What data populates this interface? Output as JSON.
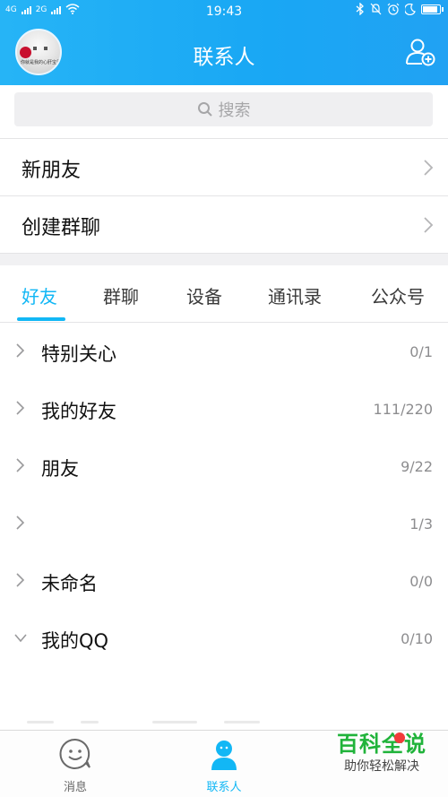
{
  "status_bar": {
    "network_1": "4G",
    "network_2": "2G",
    "time": "19:43"
  },
  "header": {
    "title": "联系人",
    "avatar_caption": "你就是我的心肝宝贝"
  },
  "search": {
    "placeholder": "搜索"
  },
  "menu": [
    {
      "label": "新朋友"
    },
    {
      "label": "创建群聊"
    }
  ],
  "tabs": [
    {
      "label": "好友",
      "active": true
    },
    {
      "label": "群聊",
      "active": false
    },
    {
      "label": "设备",
      "active": false
    },
    {
      "label": "通讯录",
      "active": false
    },
    {
      "label": "公众号",
      "active": false
    }
  ],
  "groups": [
    {
      "name": "特别关心",
      "count": "0/1",
      "expanded": false
    },
    {
      "name": "我的好友",
      "count": "111/220",
      "expanded": false
    },
    {
      "name": "朋友",
      "count": "9/22",
      "expanded": false
    },
    {
      "name": "",
      "count": "1/3",
      "expanded": false
    },
    {
      "name": "未命名",
      "count": "0/0",
      "expanded": false
    },
    {
      "name": "我的QQ",
      "count": "0/10",
      "expanded": true
    }
  ],
  "bottom_nav": [
    {
      "label": "消息",
      "icon": "smile-bubble-icon",
      "active": false
    },
    {
      "label": "联系人",
      "icon": "person-icon",
      "active": true
    }
  ],
  "watermark": {
    "brand": "百科全说",
    "slogan": "助你轻松解决"
  },
  "colors": {
    "accent": "#12b7f5",
    "header_gradient_start": "#26b4f6",
    "header_gradient_end": "#21a2f3",
    "watermark_green": "#20b33a"
  }
}
